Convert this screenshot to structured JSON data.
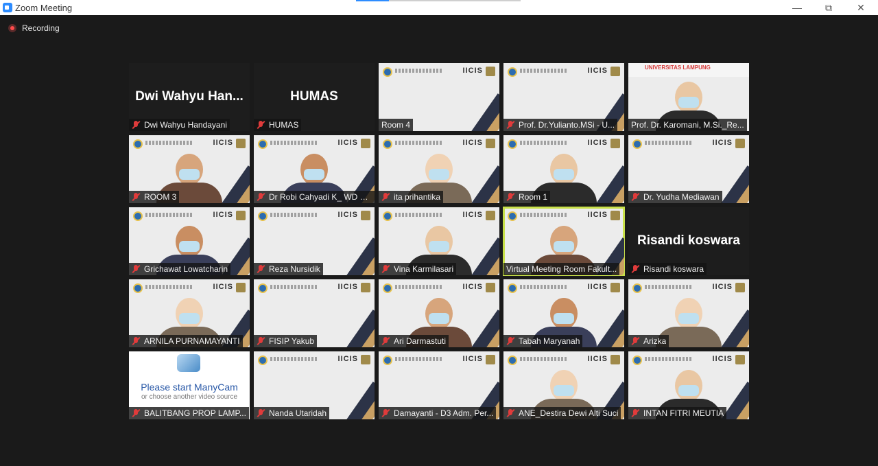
{
  "window": {
    "title": "Zoom Meeting",
    "controls": [
      "minimize-icon",
      "restore-icon",
      "close-icon"
    ]
  },
  "recording": {
    "label": "Recording"
  },
  "colors": {
    "accent": "#2d8cff",
    "active_speaker": "#c8e04a",
    "muted": "#e03b3b",
    "tile_label_bg": "#141414"
  },
  "tiles": [
    {
      "label": "Dwi Wahyu Handayani",
      "big_name": "Dwi  Wahyu  Han...",
      "kind": "name",
      "muted": true
    },
    {
      "label": "HUMAS",
      "big_name": "HUMAS",
      "kind": "name",
      "muted": true
    },
    {
      "label": "Room 4",
      "kind": "slide",
      "muted": false
    },
    {
      "label": "Prof. Dr.Yulianto.MSi - U...",
      "kind": "slide",
      "muted": true
    },
    {
      "label": "Prof. Dr. Karomani, M.Si._Re...",
      "banner": "UNIVERSITAS LAMPUNG",
      "kind": "video",
      "muted": false
    },
    {
      "label": "ROOM 3",
      "kind": "video",
      "muted": true
    },
    {
      "label": "Dr Robi Cahyadi K_ WD B...",
      "kind": "video",
      "muted": true
    },
    {
      "label": "ita prihantika",
      "kind": "video",
      "muted": true
    },
    {
      "label": "Room 1",
      "kind": "video",
      "muted": true
    },
    {
      "label": "Dr. Yudha Mediawan",
      "kind": "slide",
      "muted": true
    },
    {
      "label": "Grichawat Lowatcharin",
      "kind": "video",
      "muted": true
    },
    {
      "label": "Reza Nursidik",
      "kind": "slide",
      "muted": true
    },
    {
      "label": "Vina Karmilasari",
      "kind": "video",
      "muted": true
    },
    {
      "label": "Virtual Meeting Room Fakult...",
      "kind": "video",
      "muted": false,
      "active": true
    },
    {
      "label": "Risandi koswara",
      "big_name": "Risandi koswara",
      "kind": "name",
      "muted": true
    },
    {
      "label": "ARNILA PURNAMAYANTI",
      "kind": "video",
      "muted": true
    },
    {
      "label": "FISIP Yakub",
      "kind": "slide",
      "muted": true
    },
    {
      "label": "Ari Darmastuti",
      "kind": "video",
      "muted": true
    },
    {
      "label": "Tabah Maryanah",
      "kind": "video",
      "muted": true
    },
    {
      "label": "Arizka",
      "kind": "video",
      "muted": true
    },
    {
      "label": "BALITBANG PROP LAMP...",
      "manycam_line1": "Please start ManyCam",
      "manycam_line2": "or choose another video source",
      "kind": "manycam",
      "muted": true
    },
    {
      "label": "Nanda Utaridah",
      "kind": "slide",
      "muted": true
    },
    {
      "label": "Damayanti - D3 Adm. Per...",
      "kind": "slide",
      "muted": true
    },
    {
      "label": "ANE_Destira Dewi Alti Suci",
      "kind": "video",
      "muted": true
    },
    {
      "label": "INTAN FITRI MEUTIA",
      "kind": "video",
      "muted": true
    }
  ],
  "slide_brand": "IICIS"
}
